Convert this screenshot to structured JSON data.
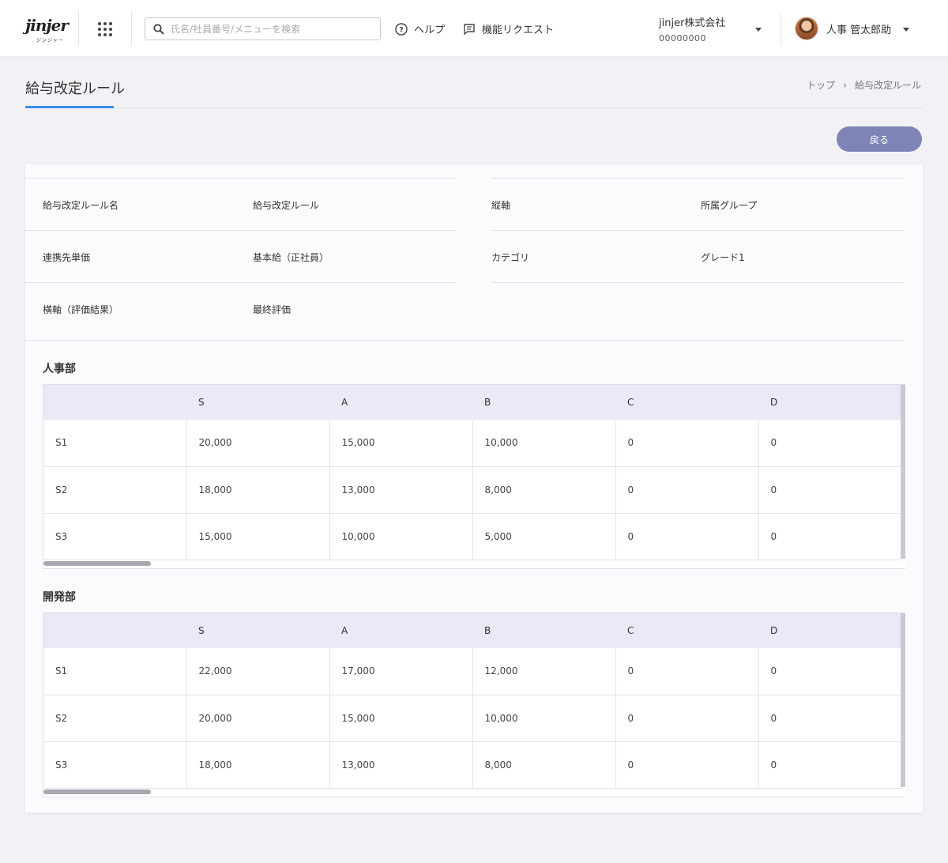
{
  "header": {
    "logo_text": "jinjer",
    "logo_sub": "ジンジャー",
    "search_placeholder": "氏名/社員番号/メニューを検索",
    "help_label": "ヘルプ",
    "request_label": "機能リクエスト",
    "company_name": "jinjer株式会社",
    "company_id": "00000000",
    "user_name": "人事 管太郎助"
  },
  "page": {
    "title": "給与改定ルール",
    "breadcrumb": [
      "トップ",
      "給与改定ルール"
    ],
    "back_label": "戻る"
  },
  "info": {
    "left": [
      {
        "label": "給与改定ルール名",
        "value": "給与改定ルール"
      },
      {
        "label": "連携先単価",
        "value": "基本給（正社員）"
      },
      {
        "label": "横軸（評価結果）",
        "value": "最終評価"
      }
    ],
    "right": [
      {
        "label": "縦軸",
        "value": "所属グループ"
      },
      {
        "label": "カテゴリ",
        "value": "グレード1"
      }
    ]
  },
  "tables": [
    {
      "title": "人事部",
      "columns": [
        "",
        "S",
        "A",
        "B",
        "C",
        "D"
      ],
      "rows": [
        [
          "S1",
          "20,000",
          "15,000",
          "10,000",
          "0",
          "0"
        ],
        [
          "S2",
          "18,000",
          "13,000",
          "8,000",
          "0",
          "0"
        ],
        [
          "S3",
          "15,000",
          "10,000",
          "5,000",
          "0",
          "0"
        ]
      ]
    },
    {
      "title": "開発部",
      "columns": [
        "",
        "S",
        "A",
        "B",
        "C",
        "D"
      ],
      "rows": [
        [
          "S1",
          "22,000",
          "17,000",
          "12,000",
          "0",
          "0"
        ],
        [
          "S2",
          "20,000",
          "15,000",
          "10,000",
          "0",
          "0"
        ],
        [
          "S3",
          "18,000",
          "13,000",
          "8,000",
          "0",
          "0"
        ]
      ]
    }
  ],
  "colors": {
    "accent": "#3a8ee8",
    "button": "#7e84b6",
    "table_header": "#e9e9f7"
  }
}
